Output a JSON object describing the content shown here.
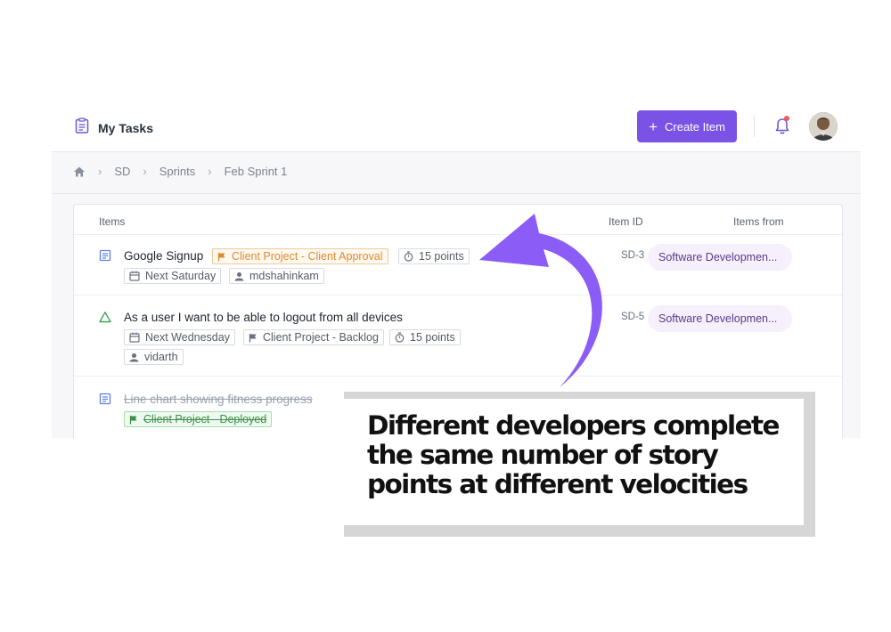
{
  "app": {
    "title": "My Tasks",
    "create_label": "Create Item"
  },
  "breadcrumb": [
    "SD",
    "Sprints",
    "Feb Sprint 1"
  ],
  "table": {
    "headers": {
      "items": "Items",
      "id": "Item ID",
      "from": "Items from"
    },
    "rows": [
      {
        "title": "Google Signup",
        "status": "Client Project - Client Approval",
        "points": "15 points",
        "due": "Next Saturday",
        "assignee": "mdshahinkam",
        "id": "SD-3",
        "from": "Software Developmen..."
      },
      {
        "title": "As a user I want to be able to logout from all devices",
        "due": "Next Wednesday",
        "status": "Client Project - Backlog",
        "points": "15 points",
        "assignee": "vidarth",
        "id": "SD-5",
        "from": "Software Developmen..."
      },
      {
        "title": "Line chart showing fitness progress",
        "status": "Client Project - Deployed"
      }
    ]
  },
  "overlay": {
    "text": "Different developers  complete the same number of story points at different velocities"
  },
  "colors": {
    "accent": "#7a52e6",
    "arrow": "#8b5cf6",
    "notification_dot": "#f05a5a"
  }
}
